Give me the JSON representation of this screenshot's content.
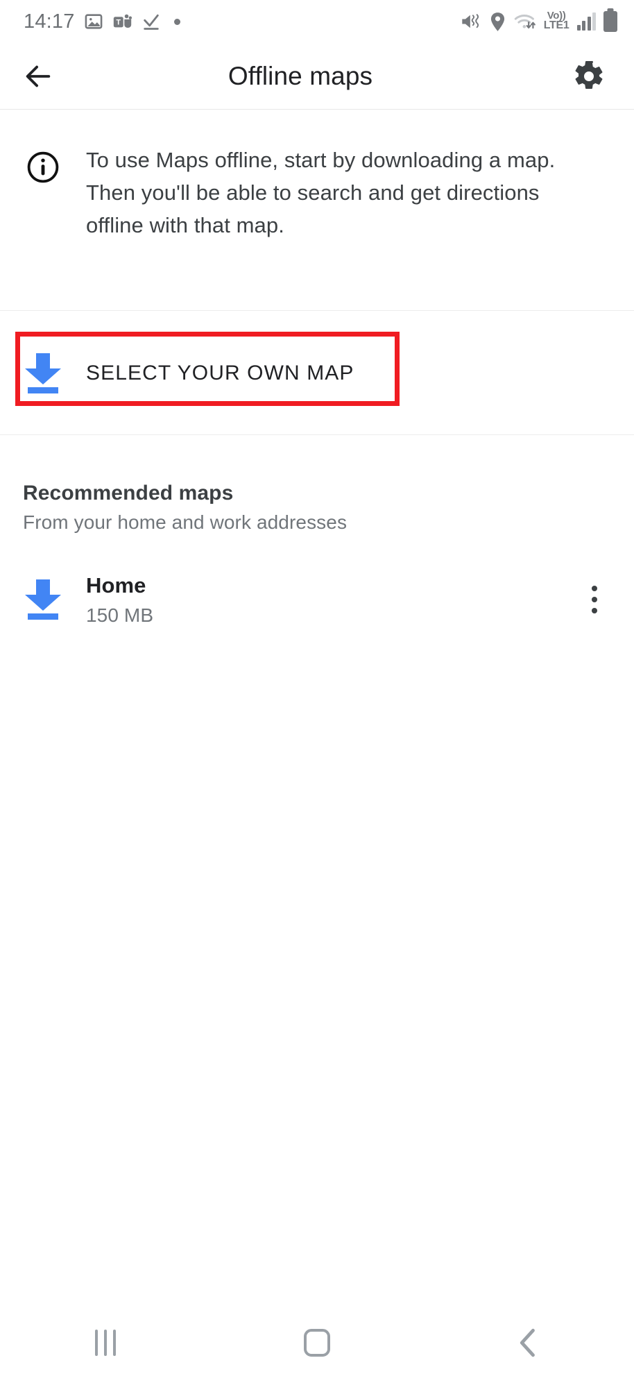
{
  "status_bar": {
    "time": "14:17",
    "left_icons": [
      "gallery-icon",
      "teams-icon",
      "checkmark-icon",
      "dot-indicator"
    ],
    "right_icons": [
      "mute-vibrate-icon",
      "location-pin-icon",
      "wifi-data-icon",
      "volte-icon",
      "signal-bars-icon",
      "battery-icon"
    ],
    "volte_top": "Vo))",
    "volte_bottom": "LTE1"
  },
  "app_bar": {
    "back_label": "back-arrow",
    "title": "Offline maps",
    "settings_label": "settings-gear"
  },
  "info": {
    "icon": "info-icon",
    "text": "To use Maps offline, start by downloading a map. Then you'll be able to search and get directions offline with that map."
  },
  "select_own_map": {
    "icon": "download-icon",
    "label": "SELECT YOUR OWN MAP",
    "highlight_color": "#f01c22",
    "highlighted": true
  },
  "recommended": {
    "title": "Recommended maps",
    "subtitle": "From your home and work addresses",
    "maps": [
      {
        "icon": "download-icon",
        "name": "Home",
        "size": "150 MB",
        "overflow": "more-options"
      }
    ]
  },
  "nav_bar": {
    "recents_label": "recents-button",
    "home_label": "home-button",
    "back_label": "back-button"
  },
  "colors": {
    "accent_blue": "#4285f4",
    "highlight_red": "#f01c22",
    "text_primary": "#202124",
    "text_secondary": "#70757a"
  }
}
